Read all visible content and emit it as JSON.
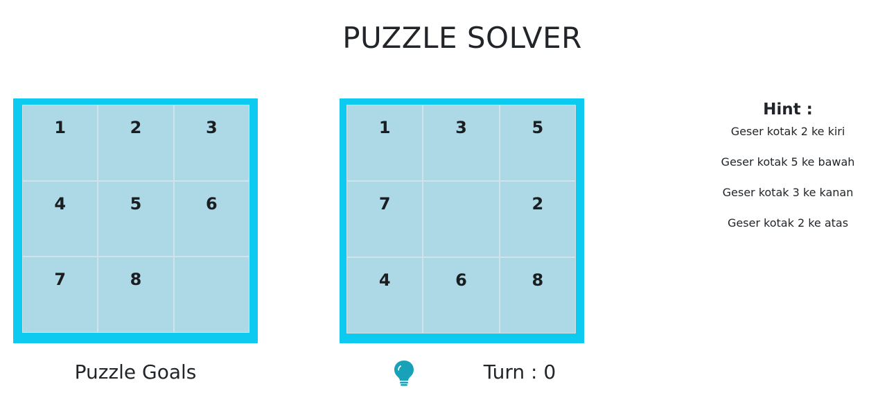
{
  "title": "PUZZLE SOLVER",
  "goal_board": {
    "tiles": [
      "1",
      "2",
      "3",
      "4",
      "5",
      "6",
      "7",
      "8",
      ""
    ]
  },
  "play_board": {
    "tiles": [
      "1",
      "3",
      "5",
      "7",
      "",
      "2",
      "4",
      "6",
      "8"
    ]
  },
  "labels": {
    "goals": "Puzzle Goals",
    "turn": "Turn : 0"
  },
  "hint": {
    "title": "Hint :",
    "items": [
      "Geser kotak 2 ke kiri",
      "Geser kotak 5 ke bawah",
      "Geser kotak 3 ke kanan",
      "Geser kotak 2 ke atas"
    ]
  },
  "colors": {
    "board_frame": "#0dcaf0",
    "tile": "#add8e6",
    "bulb": "#17a2b8",
    "text": "#212529"
  },
  "icons": {
    "hint_button": "lightbulb-icon"
  }
}
